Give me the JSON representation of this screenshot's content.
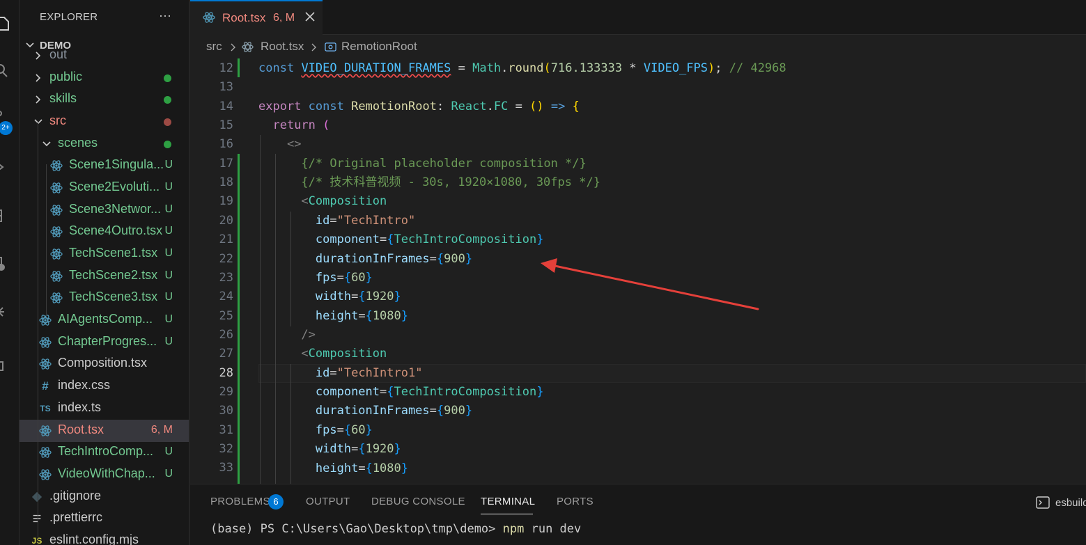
{
  "explorer": {
    "title": "EXPLORER",
    "more": "···",
    "root": "DEMO"
  },
  "activity": {
    "badge": "2+"
  },
  "tree": [
    {
      "name": "out",
      "kind": "folder",
      "color": "#8b949e"
    },
    {
      "name": "public",
      "kind": "folder",
      "color": "#73c991",
      "status": "dot",
      "status_color": "#2ea043"
    },
    {
      "name": "skills",
      "kind": "folder",
      "color": "#73c991",
      "status": "dot",
      "status_color": "#2ea043"
    },
    {
      "name": "src",
      "kind": "folder-open",
      "color": "#f1897f",
      "status": "dot",
      "status_color": "#9c4a44"
    },
    {
      "name": "scenes",
      "kind": "folder-open",
      "color": "#73c991",
      "status": "dot",
      "status_color": "#2ea043"
    },
    {
      "name": "Scene1Singula...",
      "kind": "react",
      "color": "#73c991",
      "status": "U"
    },
    {
      "name": "Scene2Evoluti...",
      "kind": "react",
      "color": "#73c991",
      "status": "U"
    },
    {
      "name": "Scene3Networ...",
      "kind": "react",
      "color": "#73c991",
      "status": "U"
    },
    {
      "name": "Scene4Outro.tsx",
      "kind": "react",
      "color": "#73c991",
      "status": "U"
    },
    {
      "name": "TechScene1.tsx",
      "kind": "react",
      "color": "#73c991",
      "status": "U"
    },
    {
      "name": "TechScene2.tsx",
      "kind": "react",
      "color": "#73c991",
      "status": "U"
    },
    {
      "name": "TechScene3.tsx",
      "kind": "react",
      "color": "#73c991",
      "status": "U"
    },
    {
      "name": "AIAgentsComp...",
      "kind": "react",
      "color": "#73c991",
      "status": "U"
    },
    {
      "name": "ChapterProgres...",
      "kind": "react",
      "color": "#73c991",
      "status": "U"
    },
    {
      "name": "Composition.tsx",
      "kind": "react",
      "color": "#cccccc"
    },
    {
      "name": "index.css",
      "kind": "css",
      "color": "#cccccc"
    },
    {
      "name": "index.ts",
      "kind": "ts",
      "color": "#cccccc"
    },
    {
      "name": "Root.tsx",
      "kind": "react",
      "color": "#f1897f",
      "status": "6, M",
      "active": true
    },
    {
      "name": "TechIntroComp...",
      "kind": "react",
      "color": "#73c991",
      "status": "U"
    },
    {
      "name": "VideoWithChap...",
      "kind": "react",
      "color": "#73c991",
      "status": "U"
    },
    {
      "name": ".gitignore",
      "kind": "git",
      "color": "#cccccc"
    },
    {
      "name": ".prettierrc",
      "kind": "list",
      "color": "#cccccc"
    },
    {
      "name": "eslint.config.mjs",
      "kind": "js",
      "color": "#cccccc"
    }
  ],
  "tab": {
    "name": "Root.tsx",
    "status": "6, M"
  },
  "breadcrumb": {
    "part1": "src",
    "part2": "Root.tsx",
    "part3": "RemotionRoot"
  },
  "code": {
    "line_numbers": [
      "12",
      "13",
      "14",
      "15",
      "16",
      "17",
      "18",
      "19",
      "20",
      "21",
      "22",
      "23",
      "24",
      "25",
      "26",
      "27",
      "28",
      "29",
      "30",
      "31",
      "32",
      "33"
    ],
    "current_line": "28",
    "comment_1": "{/* Original placeholder composition */}",
    "comment_2": "{/* 技术科普视频 - 30s, 1920×1080, 30fps */}",
    "duration_comment": "// 42968"
  },
  "panel": {
    "tabs": [
      "PROBLEMS",
      "OUTPUT",
      "DEBUG CONSOLE",
      "TERMINAL",
      "PORTS"
    ],
    "active": "TERMINAL",
    "problems_count": "6",
    "terminal_label": "esbuild",
    "prompt": "(base) PS C:\\Users\\Gao\\Desktop\\tmp\\demo> ",
    "command": "npm",
    "args": " run dev"
  },
  "colors": {
    "accent": "#0078d4",
    "modified": "#f1897f",
    "untracked": "#73c991",
    "annotation_arrow": "#e5403a"
  }
}
